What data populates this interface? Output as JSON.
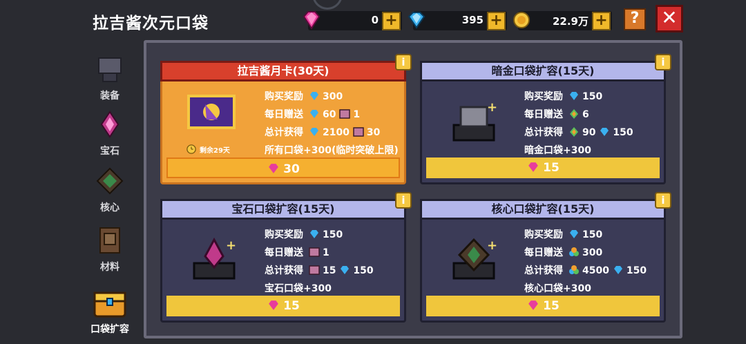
{
  "header": {
    "title": "拉吉酱次元口袋",
    "currencies": [
      {
        "icon": "pink-gem-icon",
        "value": "0"
      },
      {
        "icon": "blue-diamond-icon",
        "value": "395"
      },
      {
        "icon": "gold-coin-icon",
        "value": "22.9万"
      }
    ],
    "help_label": "?",
    "close_label": "✕"
  },
  "sidebar": {
    "items": [
      {
        "label": "装备",
        "icon": "equipment-icon"
      },
      {
        "label": "宝石",
        "icon": "gem-icon"
      },
      {
        "label": "核心",
        "icon": "core-icon"
      },
      {
        "label": "材料",
        "icon": "material-icon"
      },
      {
        "label": "口袋扩容",
        "icon": "pocket-chest-icon",
        "selected": true
      }
    ]
  },
  "cards": [
    {
      "title": "拉吉酱月卡(30天)",
      "remain": "剩余29天",
      "stats": [
        {
          "k": "购买奖励",
          "v1": "300"
        },
        {
          "k": "每日赠送",
          "v1": "60",
          "v2": "1"
        },
        {
          "k": "总计获得",
          "v1": "2100",
          "v2": "30"
        }
      ],
      "note": "所有口袋+300(临时突破上限)",
      "price": "30"
    },
    {
      "title": "暗金口袋扩容(15天)",
      "stats": [
        {
          "k": "购买奖励",
          "v1": "150"
        },
        {
          "k": "每日赠送",
          "v1": "6"
        },
        {
          "k": "总计获得",
          "v1": "90",
          "v2": "150"
        }
      ],
      "note": "暗金口袋+300",
      "price": "15"
    },
    {
      "title": "宝石口袋扩容(15天)",
      "stats": [
        {
          "k": "购买奖励",
          "v1": "150"
        },
        {
          "k": "每日赠送",
          "v1": "1"
        },
        {
          "k": "总计获得",
          "v1": "15",
          "v2": "150"
        }
      ],
      "note": "宝石口袋+300",
      "price": "15"
    },
    {
      "title": "核心口袋扩容(15天)",
      "stats": [
        {
          "k": "购买奖励",
          "v1": "150"
        },
        {
          "k": "每日赠送",
          "v1": "300"
        },
        {
          "k": "总计获得",
          "v1": "4500",
          "v2": "150"
        }
      ],
      "note": "核心口袋+300",
      "price": "15"
    }
  ],
  "colors": {
    "accent_orange": "#f1a23a",
    "card_blue": "#3b3b57",
    "price_yellow": "#f0c63c",
    "close_red": "#d32c2c"
  }
}
